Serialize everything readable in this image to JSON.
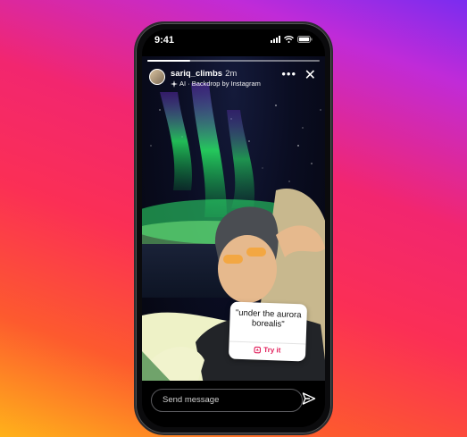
{
  "status": {
    "time": "9:41"
  },
  "story": {
    "progress": 0.25,
    "username": "sariq_climbs",
    "time_ago": "2m",
    "subtitle": "AI · Backdrop by Instagram"
  },
  "sticker": {
    "text": "\"under the aurora borealis\"",
    "cta": "Try it"
  },
  "composer": {
    "placeholder": "Send message"
  },
  "icons": [
    "sparkle-icon",
    "more-icon",
    "close-icon",
    "send-icon",
    "signal-icon",
    "wifi-icon",
    "battery-icon"
  ],
  "colors": {
    "accent": "#e11d5a"
  }
}
